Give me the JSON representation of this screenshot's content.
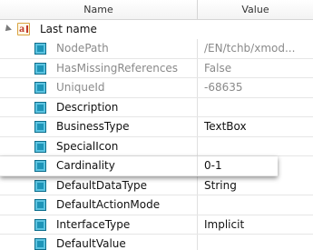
{
  "header": {
    "name_label": "Name",
    "value_label": "Value"
  },
  "category": {
    "label": "Last name",
    "icon": "text-field-icon",
    "expanded": true
  },
  "properties": [
    {
      "name": "NodePath",
      "value": "/EN/tchb/xmod...",
      "readonly": true
    },
    {
      "name": "HasMissingReferences",
      "value": "False",
      "readonly": true
    },
    {
      "name": "UniqueId",
      "value": "-68635",
      "readonly": true
    },
    {
      "name": "Description",
      "value": "",
      "readonly": false
    },
    {
      "name": "BusinessType",
      "value": "TextBox",
      "readonly": false
    },
    {
      "name": "SpecialIcon",
      "value": "",
      "readonly": false
    },
    {
      "name": "Cardinality",
      "value": "0-1",
      "readonly": false,
      "selected": true
    },
    {
      "name": "DefaultDataType",
      "value": "String",
      "readonly": false
    },
    {
      "name": "DefaultActionMode",
      "value": "",
      "readonly": false
    },
    {
      "name": "InterfaceType",
      "value": "Implicit",
      "readonly": false
    },
    {
      "name": "DefaultValue",
      "value": "",
      "readonly": false
    }
  ],
  "colors": {
    "property_icon": "#1e95b8",
    "readonly_text": "#8a8a8a",
    "category_icon_border": "#d9a441"
  }
}
